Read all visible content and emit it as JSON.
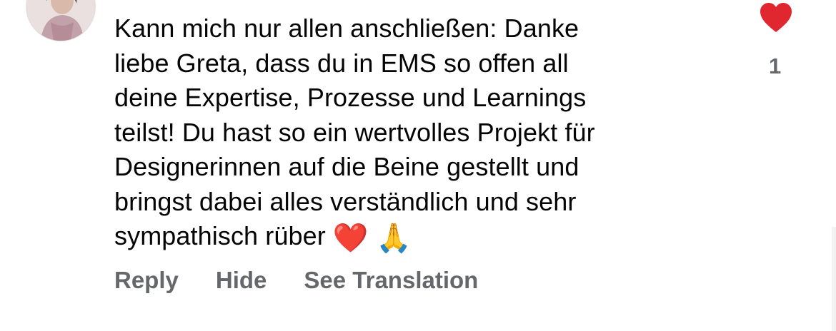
{
  "comment": {
    "text": "Kann mich nur allen anschließen: Danke\nliebe Greta, dass du in EMS so offen all\ndeine Expertise, Prozesse und Learnings\nteilst! Du hast so ein wertvolles Projekt für\nDesignerinnen auf die Beine gestellt und\nbringst dabei alles verständlich und sehr\nsympathisch rüber ",
    "emoji_1": "❤️",
    "emoji_2": "🙏"
  },
  "actions": {
    "reply": "Reply",
    "hide": "Hide",
    "see_translation": "See Translation"
  },
  "likes": {
    "icon": "heart-icon",
    "count": "1",
    "color": "#e0262f"
  },
  "colors": {
    "text": "#050505",
    "secondary": "#65676b"
  }
}
